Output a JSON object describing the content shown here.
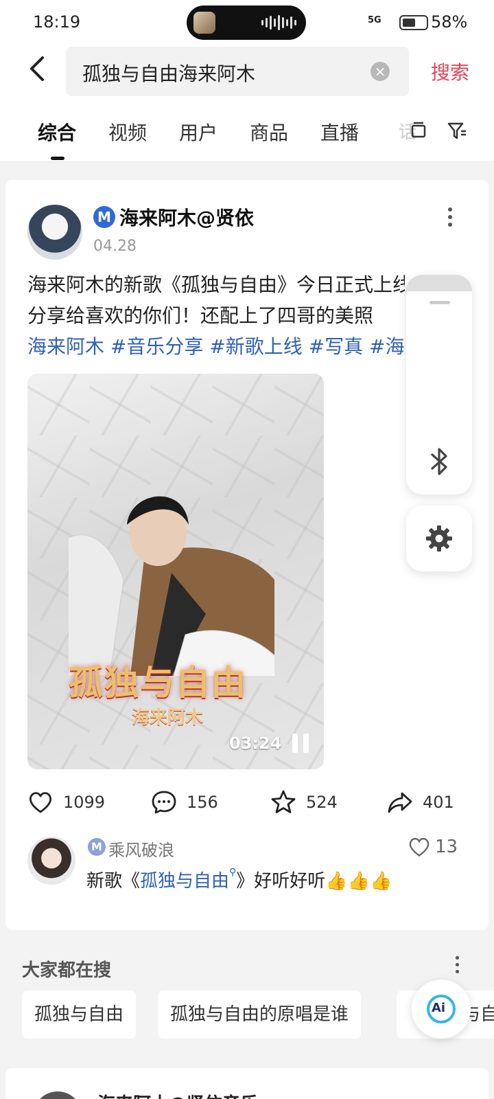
{
  "status_bar": {
    "time": "18:19",
    "signal": "5G",
    "battery": "58%"
  },
  "search": {
    "query": "孤独与自由海来阿木",
    "search_label": "搜索"
  },
  "tabs": [
    {
      "label": "综合",
      "active": true
    },
    {
      "label": "视频",
      "active": false
    },
    {
      "label": "用户",
      "active": false
    },
    {
      "label": "商品",
      "active": false
    },
    {
      "label": "直播",
      "active": false
    },
    {
      "label": "话",
      "active": false
    }
  ],
  "post": {
    "badge": "M",
    "author": "海来阿木@贤依",
    "date": "04.28",
    "text_line1": "海来阿木的新歌《孤独与自由》今日正式上线",
    "text_line2": "分享给喜欢的你们！还配上了四哥的美照",
    "tags": "海来阿木 #音乐分享 #新歌上线 #写真 #海来阿木",
    "media_title": "孤独与自由",
    "media_subtitle": "海来阿木",
    "duration": "03:24",
    "likes": "1099",
    "comments": "156",
    "favorites": "524",
    "shares": "401"
  },
  "top_comment": {
    "badge": "M",
    "user": "乘风破浪",
    "likes": "13",
    "text_before": "新歌《",
    "link": "孤独与自由",
    "text_after": "》好听好听👍👍👍"
  },
  "trending": {
    "title": "大家都在搜",
    "chips": [
      "孤独与自由",
      "孤独与自由的原唱是谁",
      "《孤独与自由》"
    ]
  },
  "next_post": {
    "author": "海来阿木@贤依音乐"
  },
  "floating": {
    "ai_label": "Ai"
  },
  "colors": {
    "accent": "#e8435a",
    "link": "#2f61b5",
    "badge": "#2f6ad8"
  }
}
